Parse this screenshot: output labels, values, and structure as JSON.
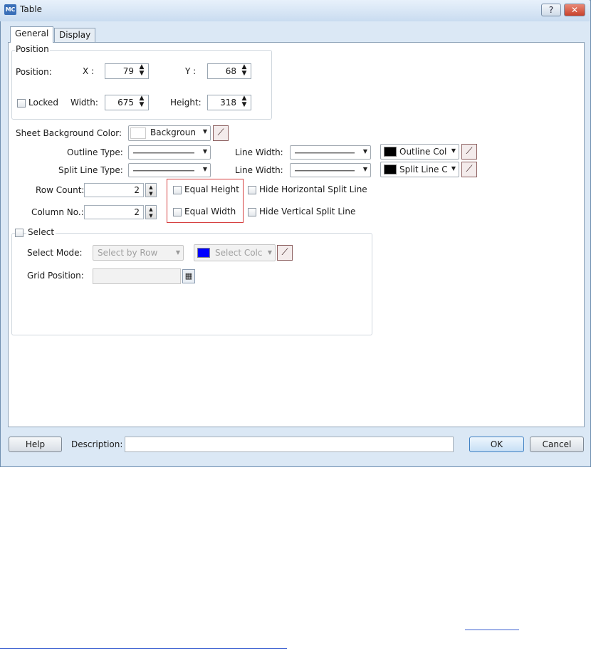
{
  "window": {
    "title": "Table",
    "app_badge": "MC",
    "help_glyph": "?",
    "close_glyph": "✕"
  },
  "tabs": [
    {
      "label": "General"
    },
    {
      "label": "Display"
    }
  ],
  "position_group": {
    "title": "Position",
    "position_label": "Position:",
    "x_label": "X :",
    "x_value": "79",
    "y_label": "Y :",
    "y_value": "68",
    "locked_label": "Locked",
    "width_label": "Width:",
    "width_value": "675",
    "height_label": "Height:",
    "height_value": "318"
  },
  "sheet_bg": {
    "label": "Sheet Background Color:",
    "value": "Backgroun",
    "swatch_color": "#ffffff"
  },
  "outline": {
    "type_label": "Outline Type:",
    "width_label": "Line Width:",
    "color_value": "Outline Col",
    "swatch_color": "#000000"
  },
  "split": {
    "type_label": "Split Line Type:",
    "width_label": "Line Width:",
    "color_value": "Split Line C",
    "swatch_color": "#000000"
  },
  "rows": {
    "label": "Row Count:",
    "value": "2"
  },
  "columns": {
    "label": "Column No.:",
    "value": "2"
  },
  "options": {
    "equal_height": "Equal Height",
    "equal_width": "Equal Width",
    "hide_horizontal": "Hide Horizontal Split Line",
    "hide_vertical": "Hide Vertical Split Line"
  },
  "select_group": {
    "title": "Select",
    "mode_label": "Select Mode:",
    "mode_value": "Select by Row",
    "color_value": "Select Colc",
    "swatch_color": "#0000ff",
    "grid_label": "Grid Position:",
    "grid_value": ""
  },
  "bottom": {
    "help_label": "Help",
    "description_label": "Description:",
    "description_value": "",
    "ok_label": "OK",
    "cancel_label": "Cancel"
  },
  "icons": {
    "picker": "eyedropper-icon",
    "spin": "spinner-arrows-icon",
    "grid": "grid-picker-icon"
  },
  "colors": {
    "accent_highlight": "#d64040",
    "link": "#3a5fd0"
  }
}
